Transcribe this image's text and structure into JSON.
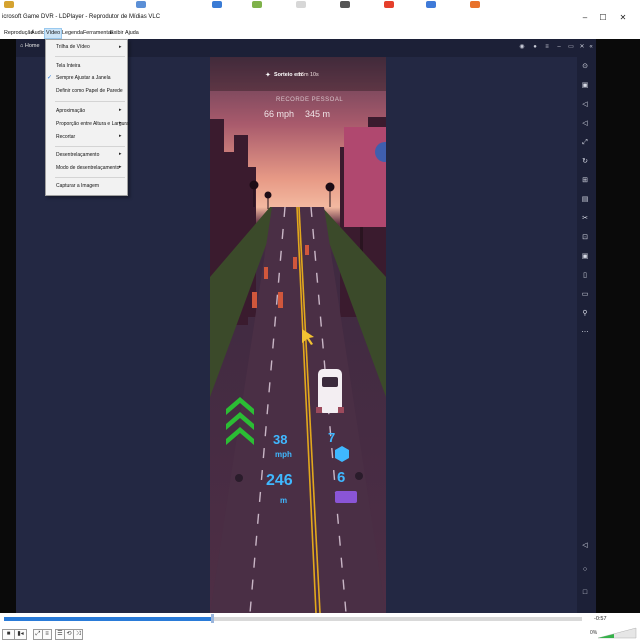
{
  "window": {
    "title": "icrosoft Game DVR - LDPlayer - Reprodutor de Mídias VLC",
    "controls": [
      "–",
      "☐",
      "✕"
    ]
  },
  "menubar": {
    "items": [
      "Reprodução",
      "Áudio",
      "Vídeo",
      "Legenda",
      "Ferramentas",
      "Exibir",
      "Ajuda"
    ],
    "active": "Vídeo"
  },
  "video_menu": {
    "items": [
      {
        "label": "Trilha de Vídeo",
        "submenu": true
      },
      {
        "label": "Tela Inteira",
        "submenu": false
      },
      {
        "label": "Sempre Ajustar a Janela",
        "submenu": false,
        "checked": true
      },
      {
        "label": "Definir como Papel de Parede",
        "submenu": false
      },
      {
        "label": "Aproximação",
        "submenu": true
      },
      {
        "label": "Proporção entre Altura e Largura",
        "submenu": true
      },
      {
        "label": "Recortar",
        "submenu": true
      },
      {
        "label": "Desentrelaçamento",
        "submenu": true
      },
      {
        "label": "Modo de desentrelaçamento",
        "submenu": true
      },
      {
        "label": "Capturar a Imagem",
        "submenu": false
      }
    ],
    "arrow": "▸",
    "check": "✓"
  },
  "emulator": {
    "home_tab": "Home",
    "header_icons": [
      "gamepad-icon",
      "user-icon",
      "menu-icon",
      "minimize-icon",
      "restore-icon",
      "close-icon",
      "collapse-icon"
    ],
    "sidebar_icons": [
      "keyboard-icon",
      "volume-up-icon",
      "volume-down-icon",
      "fullscreen-icon",
      "sync-icon",
      "add-icon",
      "apk-icon",
      "scissors-icon",
      "multi-instance-icon",
      "record-icon",
      "shake-icon",
      "folder-icon",
      "location-icon",
      "more-icon",
      "back-icon",
      "home-icon",
      "recents-icon"
    ]
  },
  "game": {
    "timer_label": "Sorteio em:",
    "timer_value": "16m 10s",
    "record_label": "RECORDE PESSOAL",
    "record_speed": "66 mph",
    "record_distance": "345 m",
    "speed": "38",
    "speed_unit": "mph",
    "distance": "246",
    "distance_unit": "m",
    "boxes": "7",
    "tickets": "6",
    "hud_color": "#3fb8ff"
  },
  "playback": {
    "progress": 0.36,
    "time_remaining": "-0:57",
    "volume_label": "0%"
  }
}
